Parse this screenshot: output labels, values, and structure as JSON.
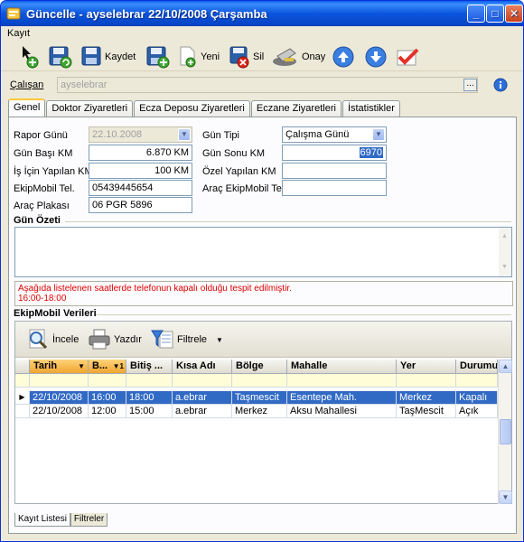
{
  "window": {
    "title": "Güncelle - ayselebrar 22/10/2008 Çarşamba",
    "min_label": "_",
    "max_label": "□",
    "close_label": "✕"
  },
  "menu": {
    "items": [
      "Kayıt"
    ]
  },
  "toolbar": {
    "save_label": "Kaydet",
    "new_label": "Yeni",
    "delete_label": "Sil",
    "approve_label": "Onay"
  },
  "calisan": {
    "label": "Çalışan",
    "value": "ayselebrar",
    "browse_label": "..."
  },
  "tabs": [
    "Genel",
    "Doktor Ziyaretleri",
    "Ecza Deposu Ziyaretleri",
    "Eczane Ziyaretleri",
    "İstatistikler"
  ],
  "form": {
    "rapor_gunu_label": "Rapor Günü",
    "rapor_gunu_value": "22.10.2008",
    "gun_tipi_label": "Gün Tipi",
    "gun_tipi_value": "Çalışma Günü",
    "gun_basi_km_label": "Gün Başı KM",
    "gun_basi_km_value": "6.870 KM",
    "gun_sonu_km_label": "Gün Sonu KM",
    "gun_sonu_km_value": "6970",
    "is_icin_km_label": "İş İçin Yapılan KM",
    "is_icin_km_value": "100 KM",
    "ozel_km_label": "Özel Yapılan KM",
    "ozel_km_value": "",
    "ekipmobil_tel_label": "EkipMobil Tel.",
    "ekipmobil_tel_value": "05439445654",
    "arac_ekipmobil_tel_label": "Araç EkipMobil Tel.",
    "arac_ekipmobil_tel_value": "",
    "arac_plakasi_label": "Araç Plakası",
    "arac_plakasi_value": "06 PGR 5896"
  },
  "gun_ozeti": {
    "label": "Gün Özeti",
    "value": ""
  },
  "warning": {
    "line1": "Aşağıda listelenen saatlerde telefonun kapalı olduğu tespit edilmiştir.",
    "line2": "16:00-18:00"
  },
  "ekipmobil": {
    "label": "EkipMobil Verileri",
    "toolbar": {
      "inspect_label": "İncele",
      "print_label": "Yazdır",
      "filter_label": "Filtrele"
    },
    "columns": [
      "Tarih",
      "B...",
      "Bitiş ...",
      "Kısa Adı",
      "Bölge",
      "Mahalle",
      "Yer",
      "Durumu"
    ],
    "sort_marker": "▼1",
    "rows": [
      [
        "22/10/2008",
        "16:00",
        "18:00",
        "a.ebrar",
        "Taşmescit",
        "Esentepe Mah.",
        "Merkez",
        "Kapalı"
      ],
      [
        "22/10/2008",
        "12:00",
        "15:00",
        "a.ebrar",
        "Merkez",
        "Aksu Mahallesi",
        "TaşMescit",
        "Açık"
      ]
    ]
  },
  "bottom_tabs": [
    "Kayıt Listesi",
    "Filtreler"
  ]
}
